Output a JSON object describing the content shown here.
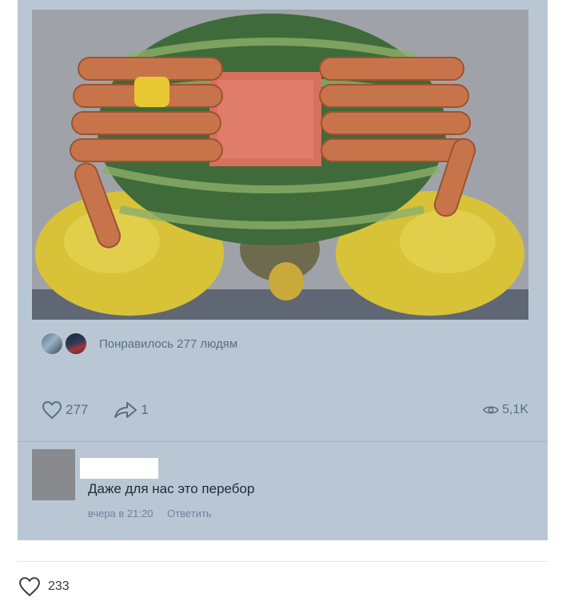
{
  "post": {
    "liked_by_text": "Понравилось 277 людям",
    "like_count": "277",
    "share_count": "1",
    "views_count": "5,1K"
  },
  "comment": {
    "text": "Даже для нас это перебор",
    "time": "вчера в 21:20",
    "reply_label": "Ответить"
  },
  "outer": {
    "like_count": "233"
  },
  "icons": {
    "like": "heart-icon",
    "share": "share-arrow-icon",
    "views": "eye-icon"
  },
  "colors": {
    "overlay_blue": "#b9c7d5",
    "muted_text": "#5c6d82"
  }
}
